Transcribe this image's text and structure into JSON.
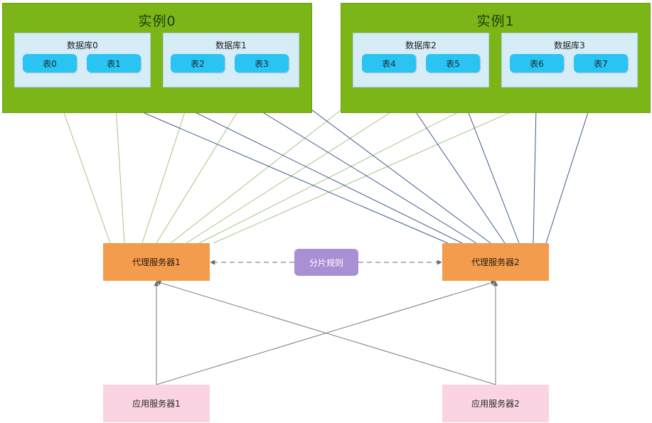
{
  "instances": [
    {
      "title": "实例0",
      "databases": [
        {
          "title": "数据库0",
          "tables": [
            "表0",
            "表1"
          ]
        },
        {
          "title": "数据库1",
          "tables": [
            "表2",
            "表3"
          ]
        }
      ]
    },
    {
      "title": "实例1",
      "databases": [
        {
          "title": "数据库2",
          "tables": [
            "表4",
            "表5"
          ]
        },
        {
          "title": "数据库3",
          "tables": [
            "表6",
            "表7"
          ]
        }
      ]
    }
  ],
  "proxies": [
    "代理服务器1",
    "代理服务器2"
  ],
  "sharding_rule": "分片规则",
  "apps": [
    "应用服务器1",
    "应用服务器2"
  ],
  "colors": {
    "instance": "#7cb518",
    "database": "#d6ecf7",
    "table": "#29c4f2",
    "proxy": "#f39c4e",
    "rule": "#a98fd3",
    "app": "#fad4e2",
    "line_green": "#a8c48a",
    "line_blue": "#3e5a8c",
    "line_gray": "#7a7a7a"
  }
}
